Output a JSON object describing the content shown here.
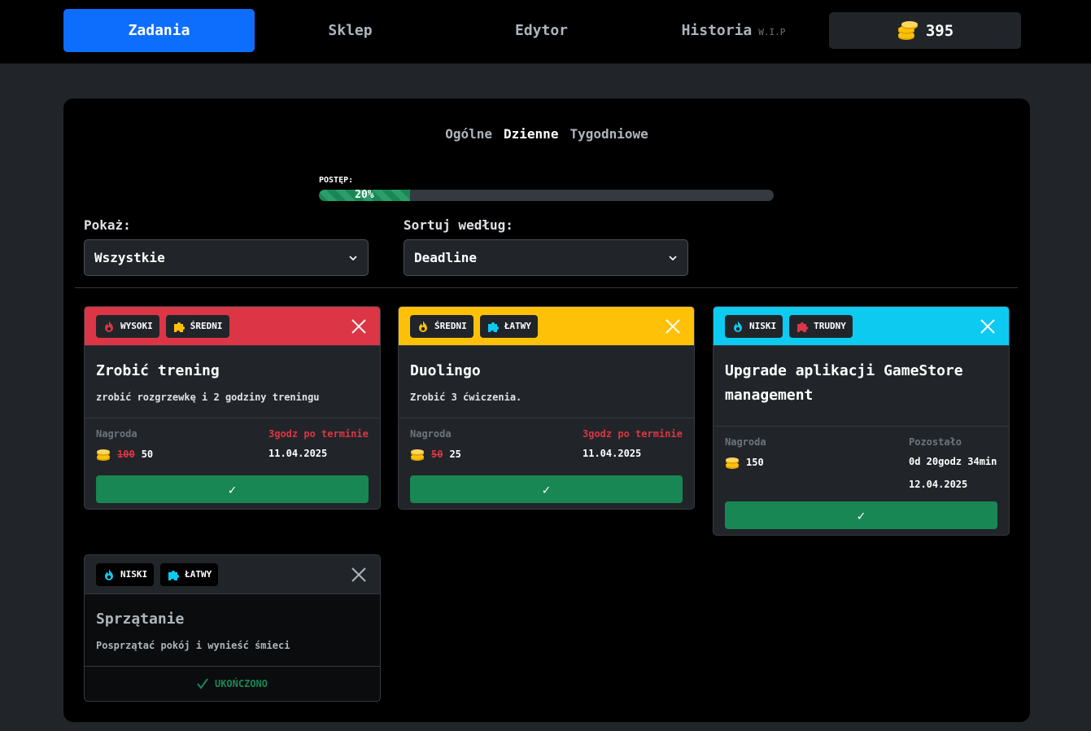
{
  "nav": {
    "items": [
      {
        "label": "Zadania",
        "active": true
      },
      {
        "label": "Sklep",
        "active": false
      },
      {
        "label": "Edytor",
        "active": false
      },
      {
        "label": "Historia",
        "suffix": "W.I.P",
        "active": false
      }
    ],
    "coins": "395"
  },
  "tabs": [
    "Ogólne",
    "Dzienne",
    "Tygodniowe"
  ],
  "active_tab": "Dzienne",
  "progress": {
    "label": "POSTĘP:",
    "value": 0.2,
    "text": "20%"
  },
  "filters": {
    "show_label": "Pokaż:",
    "show_value": "Wszystkie",
    "sort_label": "Sortuj według:",
    "sort_value": "Deadline"
  },
  "colors": {
    "high": "#dc3545",
    "medium": "#ffc107",
    "low": "#0dcaf0",
    "success": "#198754",
    "primary": "#0d6efd"
  },
  "cards": [
    {
      "priority": "WYSOKI",
      "difficulty": "ŚREDNI",
      "title": "Zrobić trening",
      "description": "zrobić rozgrzewkę i 2 godziny treningu",
      "reward_label": "Nagroda",
      "reward_old": "100",
      "reward": "50",
      "status_label": "3godz po terminie",
      "date": "11.04.2025",
      "done_label": "✓"
    },
    {
      "priority": "ŚREDNI",
      "difficulty": "ŁATWY",
      "title": "Duolingo",
      "description": "Zrobić 3 ćwiczenia.",
      "reward_label": "Nagroda",
      "reward_old": "50",
      "reward": "25",
      "status_label": "3godz po terminie",
      "date": "11.04.2025",
      "done_label": "✓"
    },
    {
      "priority": "NISKI",
      "difficulty": "TRUDNY",
      "title_line1": "Upgrade aplikacji GameStore",
      "title_line2": "management",
      "reward_label": "Nagroda",
      "reward": "150",
      "status_label": "Pozostało",
      "remaining": "0d 20godz 34min",
      "date": "12.04.2025",
      "done_label": "✓"
    },
    {
      "priority": "NISKI",
      "difficulty": "ŁATWY",
      "title": "Sprzątanie",
      "description": "Posprzątać pokój i wynieść śmieci",
      "completed_label": "UKOŃCZONO"
    }
  ]
}
